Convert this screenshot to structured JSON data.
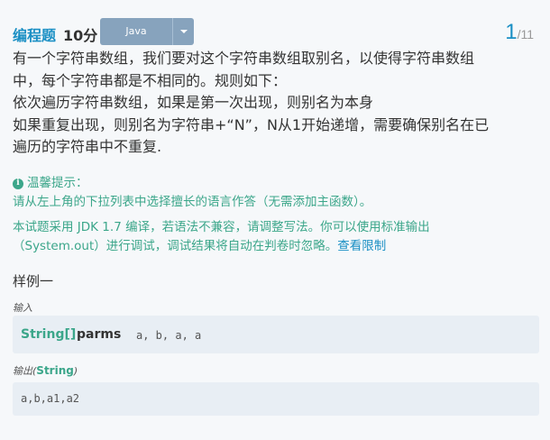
{
  "header": {
    "question_type": "编程题",
    "score": "10分",
    "language": "Java",
    "progress_current": "1",
    "progress_total": "/11"
  },
  "description": [
    "有一个字符串数组，我们要对这个字符串数组取别名，以使得字符串数组",
    "中，每个字符串都是不相同的。规则如下：",
    "依次遍历字符串数组，如果是第一次出现，则别名为本身",
    "如果重复出现，则别名为字符串+“N”，N从1开始递增，需要确保别名在已",
    "遍历的字符串中不重复."
  ],
  "tips": {
    "title": "温馨提示：",
    "line1": "请从左上角的下拉列表中选择擅长的语言作答（无需添加主函数）。",
    "line2": "本试题采用 JDK 1.7 编译，若语法不兼容，请调整写法。你可以使用标准输出",
    "line3": "（System.out）进行调试，调试结果将自动在判卷时忽略。",
    "link": "查看限制"
  },
  "sample": {
    "title": "样例一",
    "input_label": "输入",
    "param_type": "String[]",
    "param_name": "parms",
    "param_value": "a, b, a, a",
    "output_label": "输出",
    "output_type": "String",
    "output_value": "a,b,a1,a2"
  },
  "colors": {
    "accent": "#1a8fc4",
    "tip_green": "#3ba68a",
    "select_bg": "#87a3bd",
    "box_bg": "#e8eef4",
    "page_bg": "#f6f8fa"
  },
  "icons": [
    "chevron-down-icon",
    "info-icon"
  ]
}
